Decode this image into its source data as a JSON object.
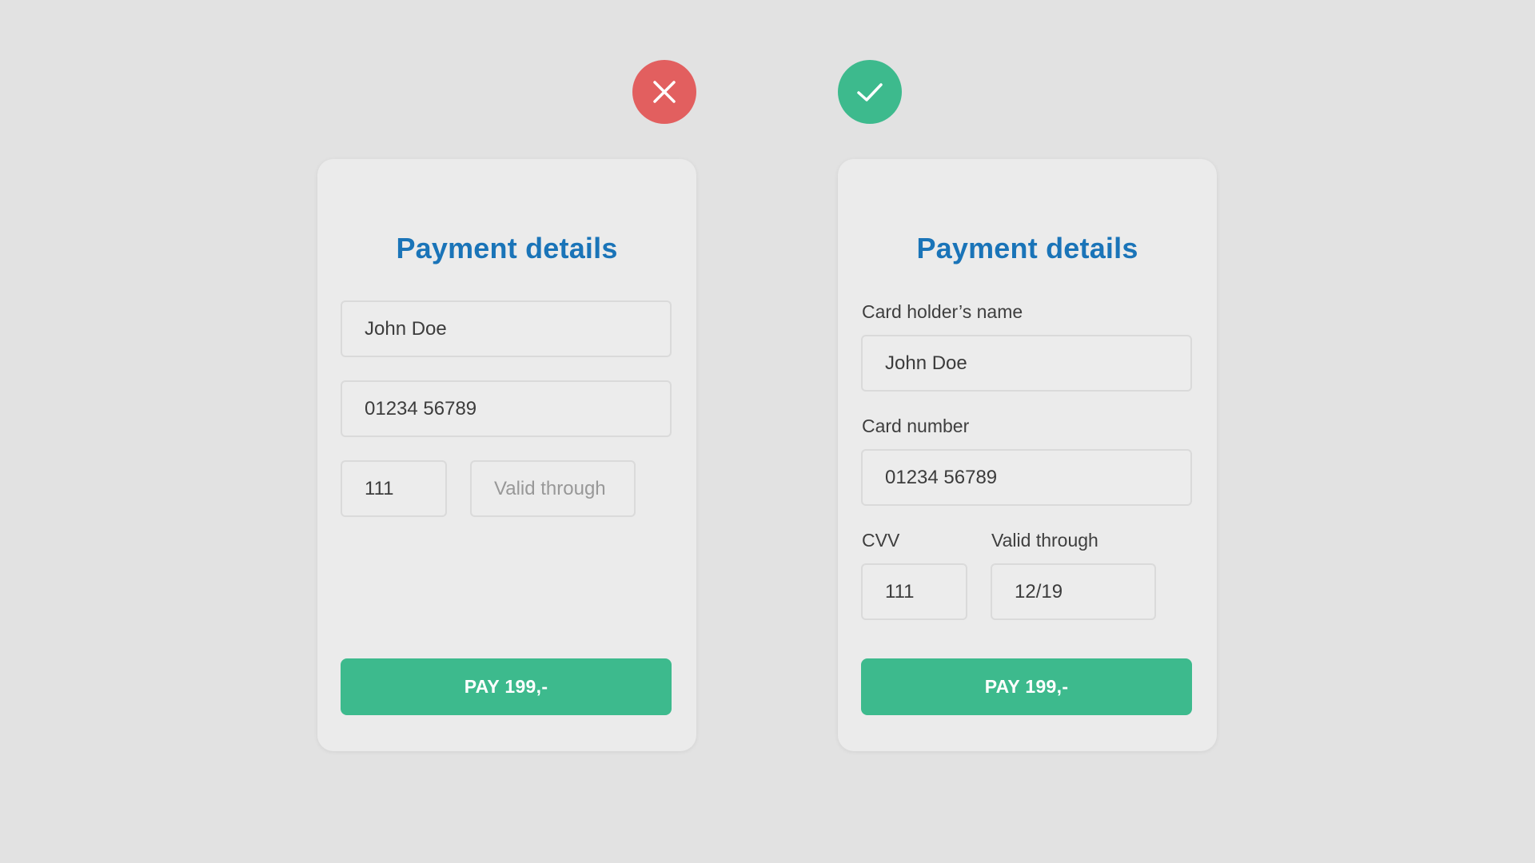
{
  "badges": {
    "bad": {
      "icon": "close-icon",
      "color": "#e25f5f"
    },
    "good": {
      "icon": "check-icon",
      "color": "#3dba8d"
    }
  },
  "bad_card": {
    "title": "Payment details",
    "name_value": "John Doe",
    "number_value": "01234 56789",
    "cvv_value": "111",
    "valid_placeholder": "Valid through",
    "pay_label": "PAY 199,-"
  },
  "good_card": {
    "title": "Payment details",
    "name_label": "Card holder’s name",
    "name_value": "John Doe",
    "number_label": "Card number",
    "number_value": "01234 56789",
    "cvv_label": "CVV",
    "cvv_value": "111",
    "valid_label": "Valid through",
    "valid_value": "12/19",
    "pay_label": "PAY 199,-"
  },
  "colors": {
    "background": "#e2e2e2",
    "card": "#ebebeb",
    "title": "#1a74b8",
    "accent_green": "#3dba8d",
    "error_red": "#e25f5f"
  }
}
